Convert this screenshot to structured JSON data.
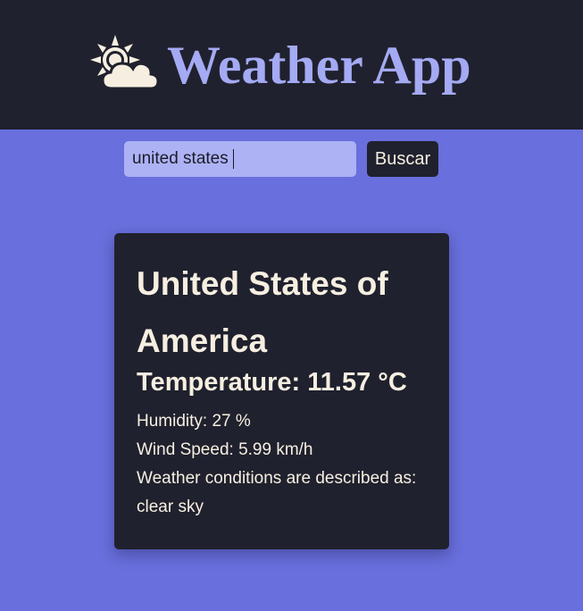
{
  "header": {
    "title": "Weather App",
    "logo_icon": "sun-behind-cloud-icon"
  },
  "search": {
    "value": "united states",
    "button_label": "Buscar"
  },
  "weather": {
    "city": "United States of America",
    "temperature": "Temperature: 11.57 °C",
    "humidity": "Humidity: 27 %",
    "wind_speed": "Wind Speed: 5.99 km/h",
    "conditions": "Weather conditions are described as: clear sky"
  },
  "colors": {
    "background": "#696fdc",
    "header_bg": "#20212e",
    "title": "#a4aaf3",
    "input_bg": "#adb2f5",
    "card_bg": "#20212e",
    "text_light": "#f6efe1"
  }
}
